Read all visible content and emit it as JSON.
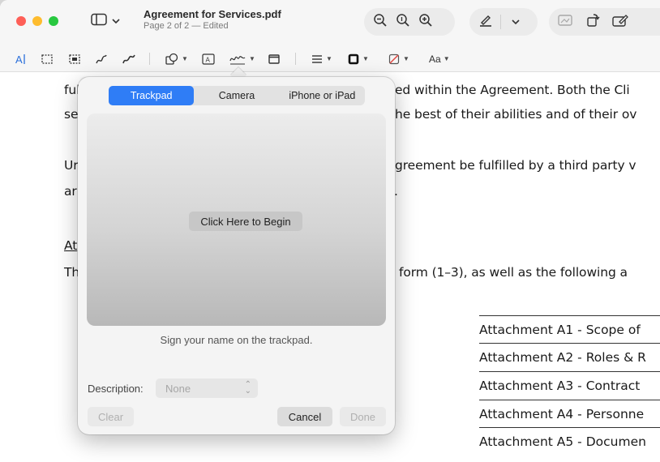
{
  "window": {
    "title": "Agreement for Services.pdf",
    "subtitle": "Page 2 of 2 — Edited"
  },
  "toolbar": {
    "icons": [
      "sidebar-icon",
      "zoom-out-icon",
      "actual-size-icon",
      "zoom-in-icon",
      "highlight-pen-icon",
      "rotate-icon",
      "markup-icon"
    ]
  },
  "markup_toolbar": {
    "text_style_label": "Aa"
  },
  "document": {
    "line1": "ed within the Agreement. Both the Cli",
    "line1_prefix": "ful",
    "line2": "he best of their abilities and of their ov",
    "line2_prefix": "se",
    "line3": "greement be fulfilled by a third party v",
    "line3_prefix": "Ur",
    "line4": ".",
    "line4_prefix": "ar",
    "heading_prefix": "At",
    "line5_prefix": "Th",
    "line5": "form (1–3), as well as the following a",
    "attachments": [
      "Attachment A1 - Scope of",
      "Attachment A2 - Roles & R",
      "Attachment A3 - Contract",
      "Attachment A4 - Personne",
      "Attachment A5 - Documen"
    ]
  },
  "signature_popover": {
    "tabs": [
      "Trackpad",
      "Camera",
      "iPhone or iPad"
    ],
    "active_tab": "Trackpad",
    "begin_button": "Click Here to Begin",
    "hint": "Sign your name on the trackpad.",
    "description_label": "Description:",
    "description_value": "None",
    "clear_label": "Clear",
    "cancel_label": "Cancel",
    "done_label": "Done"
  },
  "colors": {
    "accent": "#2f7df6",
    "traffic_red": "#fe5f57",
    "traffic_yellow": "#febc2e",
    "traffic_green": "#28c840"
  }
}
